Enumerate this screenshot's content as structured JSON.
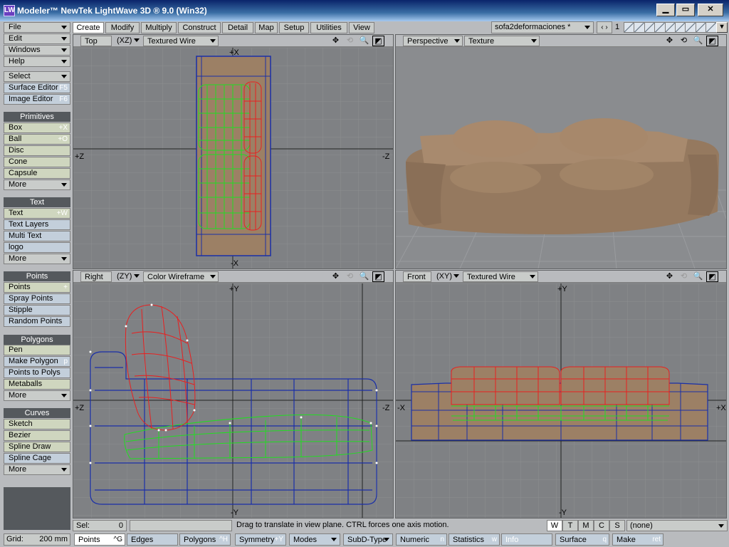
{
  "window": {
    "title": "Modeler™ NewTek LightWave 3D ® 9.0 (Win32)",
    "min": "▁",
    "max": "▭",
    "close": "✕",
    "icon": "LW"
  },
  "menu": [
    {
      "label": "File"
    },
    {
      "label": "Edit"
    },
    {
      "label": "Windows"
    },
    {
      "label": "Help"
    }
  ],
  "select": {
    "label": "Select"
  },
  "surface_editor": {
    "label": "Surface Editor",
    "shortcut": "F5"
  },
  "image_editor": {
    "label": "Image Editor",
    "shortcut": "F6"
  },
  "groups": {
    "primitives": {
      "header": "Primitives",
      "items": [
        {
          "label": "Box",
          "shortcut": "+X"
        },
        {
          "label": "Ball",
          "shortcut": "+O"
        },
        {
          "label": "Disc",
          "shortcut": ""
        },
        {
          "label": "Cone",
          "shortcut": ""
        },
        {
          "label": "Capsule",
          "shortcut": ""
        },
        {
          "label": "More",
          "shortcut": ""
        }
      ]
    },
    "text": {
      "header": "Text",
      "items": [
        {
          "label": "Text",
          "shortcut": "+W"
        },
        {
          "label": "Text Layers",
          "shortcut": ""
        },
        {
          "label": "Multi Text",
          "shortcut": ""
        },
        {
          "label": "logo",
          "shortcut": ""
        },
        {
          "label": "More",
          "shortcut": ""
        }
      ]
    },
    "points": {
      "header": "Points",
      "items": [
        {
          "label": "Points",
          "shortcut": "+"
        },
        {
          "label": "Spray Points",
          "shortcut": ""
        },
        {
          "label": "Stipple",
          "shortcut": ""
        },
        {
          "label": "Random Points",
          "shortcut": ""
        }
      ]
    },
    "polygons": {
      "header": "Polygons",
      "items": [
        {
          "label": "Pen",
          "shortcut": ""
        },
        {
          "label": "Make Polygon",
          "shortcut": "p"
        },
        {
          "label": "Points to Polys",
          "shortcut": ""
        },
        {
          "label": "Metaballs",
          "shortcut": ""
        },
        {
          "label": "More",
          "shortcut": ""
        }
      ]
    },
    "curves": {
      "header": "Curves",
      "items": [
        {
          "label": "Sketch",
          "shortcut": ""
        },
        {
          "label": "Bezier",
          "shortcut": ""
        },
        {
          "label": "Spline Draw",
          "shortcut": ""
        },
        {
          "label": "Spline Cage",
          "shortcut": ""
        },
        {
          "label": "More",
          "shortcut": ""
        }
      ]
    }
  },
  "tabs": [
    "Create",
    "Modify",
    "Multiply",
    "Construct",
    "Detail",
    "Map",
    "Setup",
    "Utilities",
    "View"
  ],
  "active_tab": "Create",
  "file_select": {
    "value": "sofa2deformaciones *"
  },
  "nav": {
    "arrows": "‹ ›"
  },
  "layer": {
    "number": "1"
  },
  "viewports": {
    "top": {
      "view": "Top",
      "axes": "(XZ)",
      "mode": "Textured Wire",
      "axis_top": "+X",
      "axis_bottom": "-X",
      "axis_left": "+Z",
      "axis_right": "-Z"
    },
    "persp": {
      "view": "Perspective",
      "mode": "Texture"
    },
    "right": {
      "view": "Right",
      "axes": "(ZY)",
      "mode": "Color Wireframe",
      "axis_top": "+Y",
      "axis_bottom": "-Y",
      "axis_left": "+Z",
      "axis_right": "-Z"
    },
    "front": {
      "view": "Front",
      "axes": "(XY)",
      "mode": "Textured Wire",
      "axis_top": "+Y",
      "axis_bottom": "-Y",
      "axis_left": "-X",
      "axis_right": "+X"
    }
  },
  "status": {
    "sel_label": "Sel:",
    "sel_value": "0",
    "message": "Drag to translate in view plane. CTRL forces one axis motion.",
    "wtmcs": [
      "W",
      "T",
      "M",
      "C",
      "S"
    ],
    "surface": "(none)"
  },
  "grid": {
    "label": "Grid:",
    "value": "200 mm"
  },
  "bottom": {
    "points": "Points",
    "points_sc": "^G",
    "edges": "Edges",
    "polygons": "Polygons",
    "polygons_sc": "^H",
    "symmetry": "Symmetry",
    "symmetry_sc": "+Y",
    "modes": "Modes",
    "subd": "SubD-Type",
    "numeric": "Numeric",
    "numeric_sc": "n",
    "statistics": "Statistics",
    "statistics_sc": "w",
    "info": "Info",
    "surface": "Surface",
    "surface_sc": "q",
    "make": "Make",
    "make_sc": "ret"
  },
  "colors": {
    "viewport_bg": "#7f8184",
    "sofa": "#9c8065",
    "wire_green": "#22dd22",
    "wire_red": "#e82020",
    "wire_blue": "#1a2fa8",
    "header_dark": "#55595d"
  }
}
